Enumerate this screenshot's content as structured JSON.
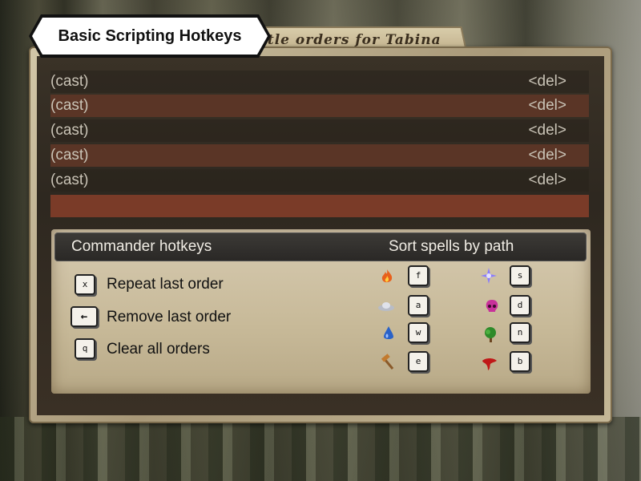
{
  "badge": {
    "title": "Basic Scripting Hotkeys"
  },
  "window": {
    "title_tab": "ttle orders for Tabina"
  },
  "orders": [
    {
      "action": "(cast)",
      "delete": "<del>"
    },
    {
      "action": "(cast)",
      "delete": "<del>"
    },
    {
      "action": "(cast)",
      "delete": "<del>"
    },
    {
      "action": "(cast)",
      "delete": "<del>"
    },
    {
      "action": "(cast)",
      "delete": "<del>"
    }
  ],
  "hotkeys": {
    "commander_header": "Commander hotkeys",
    "sort_header": "Sort spells by path",
    "commander": [
      {
        "key": "x",
        "label": "Repeat last order"
      },
      {
        "key": "←",
        "label": "Remove last order"
      },
      {
        "key": "q",
        "label": "Clear all orders"
      }
    ],
    "paths": [
      {
        "icon": "fire-icon",
        "key": "f"
      },
      {
        "icon": "air-icon",
        "key": "a"
      },
      {
        "icon": "water-icon",
        "key": "w"
      },
      {
        "icon": "earth-icon",
        "key": "e"
      },
      {
        "icon": "astral-icon",
        "key": "s"
      },
      {
        "icon": "death-icon",
        "key": "d"
      },
      {
        "icon": "nature-icon",
        "key": "n"
      },
      {
        "icon": "blood-icon",
        "key": "b"
      }
    ]
  },
  "colors": {
    "selected_row": "#7a3b28",
    "alt_row": "#5a3526",
    "header_bg": "#2a2826",
    "parchment": "#c7b998"
  }
}
